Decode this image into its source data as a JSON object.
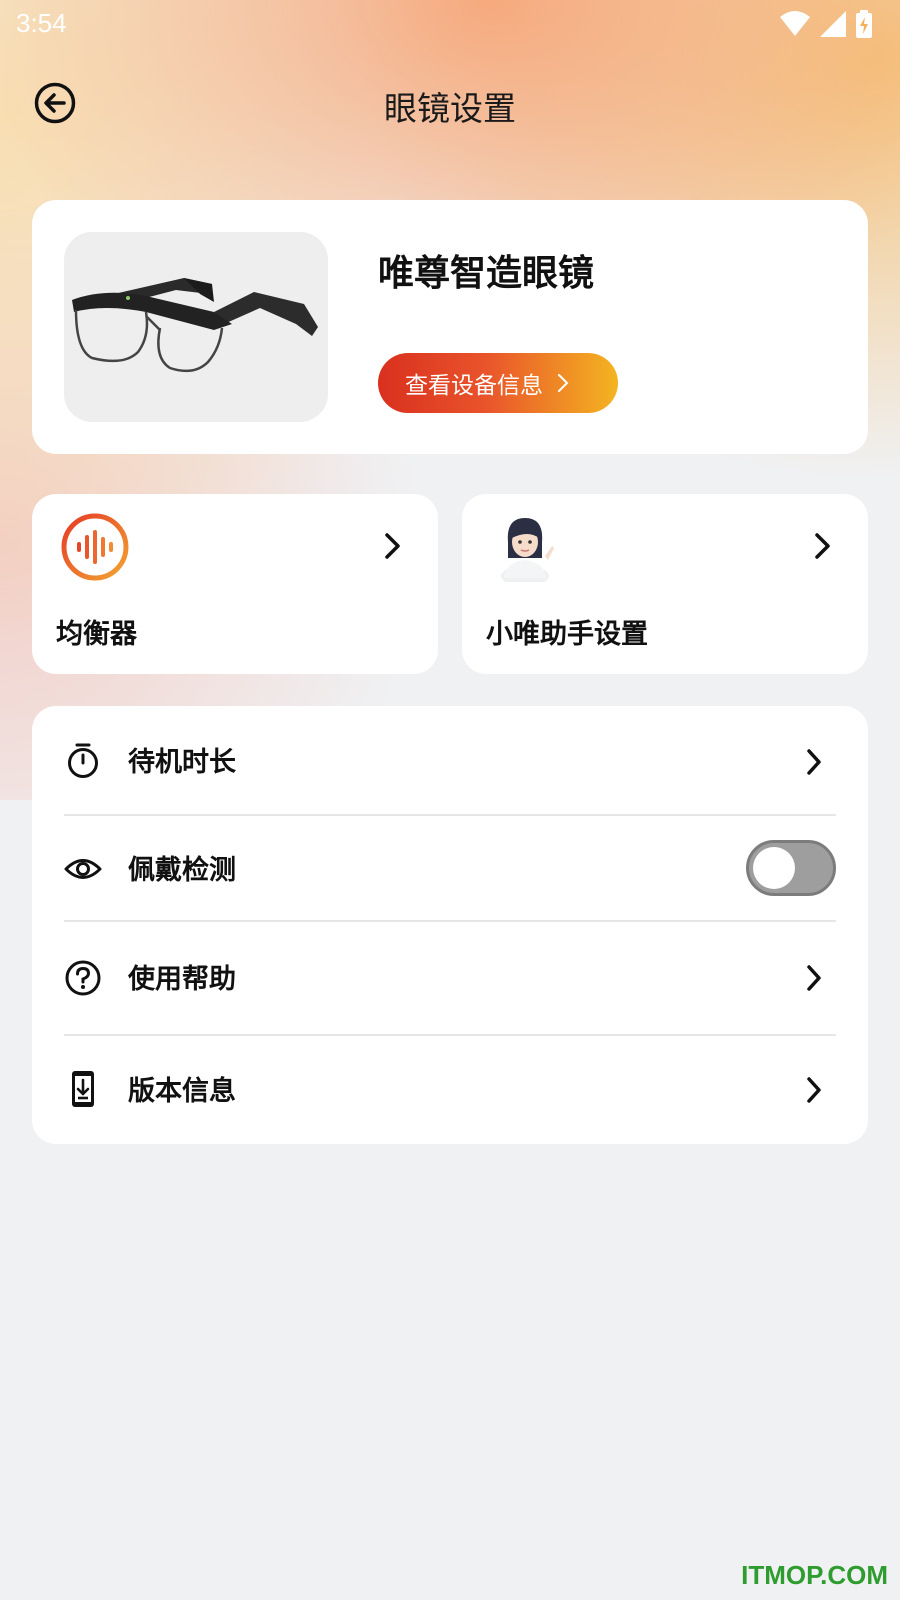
{
  "status_bar": {
    "time": "3:54"
  },
  "header": {
    "title": "眼镜设置"
  },
  "device": {
    "name": "唯尊智造眼镜",
    "info_button_label": "查看设备信息"
  },
  "features": [
    {
      "label": "均衡器"
    },
    {
      "label": "小唯助手设置"
    }
  ],
  "settings": [
    {
      "label": "待机时长",
      "icon": "timer-icon"
    },
    {
      "label": "佩戴检测",
      "icon": "eye-icon",
      "toggle_on": false
    },
    {
      "label": "使用帮助",
      "icon": "help-icon"
    },
    {
      "label": "版本信息",
      "icon": "download-icon"
    }
  ],
  "colors": {
    "accent_start": "#d9301e",
    "accent_end": "#f4b421",
    "toggle_off": "#9e9e9e"
  },
  "watermark": "ITMOP.COM"
}
